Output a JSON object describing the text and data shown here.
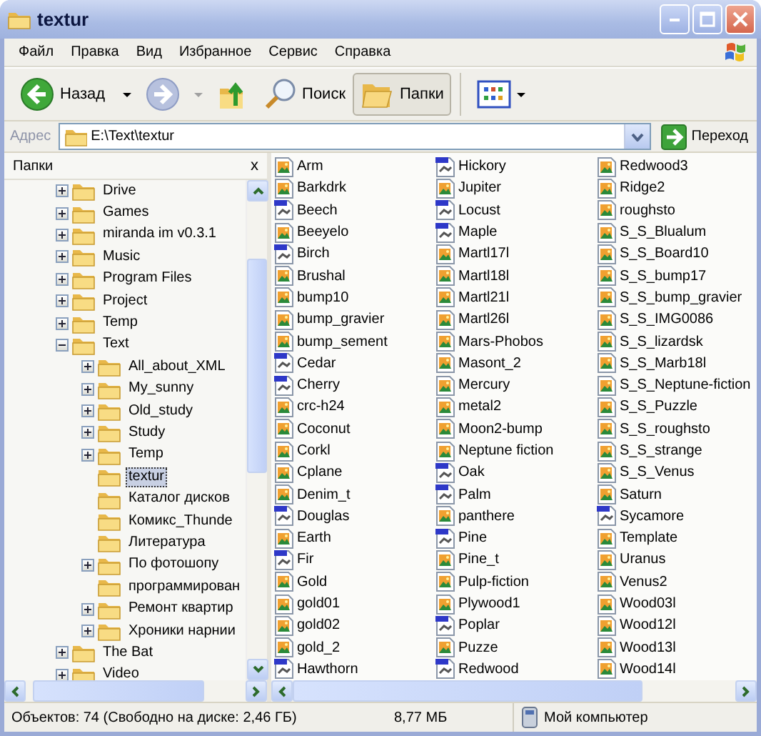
{
  "window": {
    "title": "textur"
  },
  "menu": [
    "Файл",
    "Правка",
    "Вид",
    "Избранное",
    "Сервис",
    "Справка"
  ],
  "toolbar": {
    "back": {
      "label": "Назад"
    },
    "forward": {
      "disabled": true
    },
    "search": {
      "label": "Поиск"
    },
    "folders": {
      "label": "Папки",
      "selected": true
    }
  },
  "address": {
    "label": "Адрес",
    "value": "E:\\Text\\textur",
    "go": "Переход"
  },
  "folders_pane": {
    "title": "Папки",
    "close": "x"
  },
  "tree": [
    {
      "label": "Drive",
      "expandable": true,
      "expanded": false,
      "selected": false
    },
    {
      "label": "Games",
      "expandable": true,
      "expanded": false,
      "selected": false
    },
    {
      "label": "miranda im v0.3.1",
      "expandable": true,
      "expanded": false,
      "selected": false
    },
    {
      "label": "Music",
      "expandable": true,
      "expanded": false,
      "selected": false
    },
    {
      "label": "Program Files",
      "expandable": true,
      "expanded": false,
      "selected": false
    },
    {
      "label": "Project",
      "expandable": true,
      "expanded": false,
      "selected": false
    },
    {
      "label": "Temp",
      "expandable": true,
      "expanded": false,
      "selected": false
    },
    {
      "label": "Text",
      "expandable": true,
      "expanded": true,
      "selected": false,
      "children": [
        {
          "label": "All_about_XML",
          "expandable": true,
          "expanded": false,
          "selected": false
        },
        {
          "label": "My_sunny",
          "expandable": true,
          "expanded": false,
          "selected": false
        },
        {
          "label": "Old_study",
          "expandable": true,
          "expanded": false,
          "selected": false
        },
        {
          "label": "Study",
          "expandable": true,
          "expanded": false,
          "selected": false
        },
        {
          "label": "Temp",
          "expandable": true,
          "expanded": false,
          "selected": false
        },
        {
          "label": "textur",
          "expandable": false,
          "selected": true
        },
        {
          "label": "Каталог дисков",
          "expandable": false,
          "selected": false
        },
        {
          "label": "Комикс_Thunde",
          "expandable": false,
          "selected": false
        },
        {
          "label": "Литература",
          "expandable": false,
          "selected": false
        },
        {
          "label": "По фотошопу",
          "expandable": true,
          "expanded": false,
          "selected": false
        },
        {
          "label": "программирован",
          "expandable": false,
          "selected": false
        },
        {
          "label": "Ремонт квартир",
          "expandable": true,
          "expanded": false,
          "selected": false
        },
        {
          "label": "Хроники нарнии",
          "expandable": true,
          "expanded": false,
          "selected": false
        }
      ]
    },
    {
      "label": "The Bat",
      "expandable": true,
      "expanded": false,
      "selected": false
    },
    {
      "label": "Video",
      "expandable": true,
      "expanded": false,
      "selected": false
    }
  ],
  "files": [
    {
      "name": "Arm",
      "kind": "image"
    },
    {
      "name": "Barkdrk",
      "kind": "image"
    },
    {
      "name": "Beech",
      "kind": "bitmap"
    },
    {
      "name": "Beeyelo",
      "kind": "image"
    },
    {
      "name": "Birch",
      "kind": "bitmap"
    },
    {
      "name": "Brushal",
      "kind": "image"
    },
    {
      "name": "bump10",
      "kind": "image"
    },
    {
      "name": "bump_gravier",
      "kind": "image"
    },
    {
      "name": "bump_sement",
      "kind": "image"
    },
    {
      "name": "Cedar",
      "kind": "bitmap"
    },
    {
      "name": "Cherry",
      "kind": "bitmap"
    },
    {
      "name": "crc-h24",
      "kind": "image"
    },
    {
      "name": "Coconut",
      "kind": "image"
    },
    {
      "name": "Corkl",
      "kind": "image"
    },
    {
      "name": "Cplane",
      "kind": "image"
    },
    {
      "name": "Denim_t",
      "kind": "image"
    },
    {
      "name": "Douglas",
      "kind": "bitmap"
    },
    {
      "name": "Earth",
      "kind": "image"
    },
    {
      "name": "Fir",
      "kind": "bitmap"
    },
    {
      "name": "Gold",
      "kind": "image"
    },
    {
      "name": "gold01",
      "kind": "image"
    },
    {
      "name": "gold02",
      "kind": "image"
    },
    {
      "name": "gold_2",
      "kind": "image"
    },
    {
      "name": "Hawthorn",
      "kind": "bitmap"
    },
    {
      "name": "Hickory",
      "kind": "bitmap"
    },
    {
      "name": "Jupiter",
      "kind": "image"
    },
    {
      "name": "Locust",
      "kind": "bitmap"
    },
    {
      "name": "Maple",
      "kind": "bitmap"
    },
    {
      "name": "Martl17l",
      "kind": "image"
    },
    {
      "name": "Martl18l",
      "kind": "image"
    },
    {
      "name": "Martl21l",
      "kind": "image"
    },
    {
      "name": "Martl26l",
      "kind": "image"
    },
    {
      "name": "Mars-Phobos",
      "kind": "image"
    },
    {
      "name": "Masont_2",
      "kind": "image"
    },
    {
      "name": "Mercury",
      "kind": "image"
    },
    {
      "name": "metal2",
      "kind": "image"
    },
    {
      "name": "Moon2-bump",
      "kind": "image"
    },
    {
      "name": "Neptune fiction",
      "kind": "image"
    },
    {
      "name": "Oak",
      "kind": "bitmap"
    },
    {
      "name": "Palm",
      "kind": "bitmap"
    },
    {
      "name": "panthere",
      "kind": "image"
    },
    {
      "name": "Pine",
      "kind": "bitmap"
    },
    {
      "name": "Pine_t",
      "kind": "image"
    },
    {
      "name": "Pulp-fiction",
      "kind": "image"
    },
    {
      "name": "Plywood1",
      "kind": "image"
    },
    {
      "name": "Poplar",
      "kind": "bitmap"
    },
    {
      "name": "Puzze",
      "kind": "image"
    },
    {
      "name": "Redwood",
      "kind": "bitmap"
    },
    {
      "name": "Redwood3",
      "kind": "image"
    },
    {
      "name": "Ridge2",
      "kind": "image"
    },
    {
      "name": "roughsto",
      "kind": "image"
    },
    {
      "name": "S_S_Blualum",
      "kind": "image"
    },
    {
      "name": "S_S_Board10",
      "kind": "image"
    },
    {
      "name": "S_S_bump17",
      "kind": "image"
    },
    {
      "name": "S_S_bump_gravier",
      "kind": "image"
    },
    {
      "name": "S_S_IMG0086",
      "kind": "image"
    },
    {
      "name": "S_S_lizardsk",
      "kind": "image"
    },
    {
      "name": "S_S_Marb18l",
      "kind": "image"
    },
    {
      "name": "S_S_Neptune-fiction",
      "kind": "image"
    },
    {
      "name": "S_S_Puzzle",
      "kind": "image"
    },
    {
      "name": "S_S_roughsto",
      "kind": "image"
    },
    {
      "name": "S_S_strange",
      "kind": "image"
    },
    {
      "name": "S_S_Venus",
      "kind": "image"
    },
    {
      "name": "Saturn",
      "kind": "image"
    },
    {
      "name": "Sycamore",
      "kind": "bitmap"
    },
    {
      "name": "Template",
      "kind": "image"
    },
    {
      "name": "Uranus",
      "kind": "image"
    },
    {
      "name": "Venus2",
      "kind": "image"
    },
    {
      "name": "Wood03l",
      "kind": "image"
    },
    {
      "name": "Wood12l",
      "kind": "image"
    },
    {
      "name": "Wood13l",
      "kind": "image"
    },
    {
      "name": "Wood14l",
      "kind": "image"
    }
  ],
  "status_bar": {
    "objects": "Объектов: 74 (Свободно на диске: 2,46 ГБ)",
    "size": "8,77 МБ",
    "location": "Мой компьютер"
  }
}
